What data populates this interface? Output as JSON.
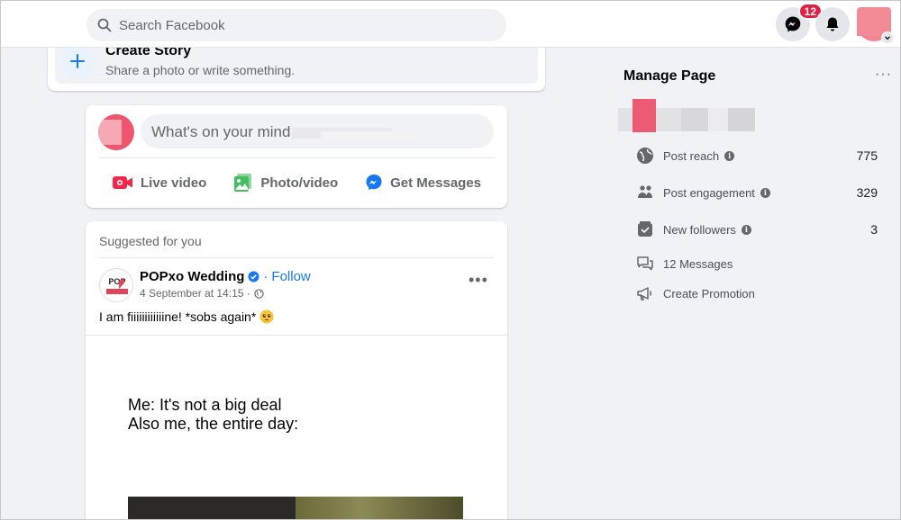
{
  "topbar": {
    "search_placeholder": "Search Facebook",
    "messenger_badge": "12"
  },
  "story": {
    "title": "Create Story",
    "subtitle": "Share a photo or write something."
  },
  "composer": {
    "prompt": "What's on your mind,",
    "actions": [
      {
        "label": "Live video",
        "icon": "live-video-icon",
        "color": "#f02849"
      },
      {
        "label": "Photo/video",
        "icon": "photo-video-icon",
        "color": "#45bd62"
      },
      {
        "label": "Get Messages",
        "icon": "messenger-icon",
        "color": "#1877f2"
      }
    ]
  },
  "post": {
    "section_label": "Suggested for you",
    "author": "POPxo Wedding",
    "follow": "Follow",
    "separator": "·",
    "timestamp": "4 September at 14:15 ·",
    "text": "I am fiiiiiiiiiiiine! *sobs again*",
    "meme_line1": "Me: It's not a big deal",
    "meme_line2": "Also me, the entire day:"
  },
  "manage_page": {
    "title": "Manage Page",
    "more": "···",
    "stats": [
      {
        "label": "Post reach",
        "value": "775",
        "icon": "globe-icon",
        "info": true
      },
      {
        "label": "Post engagement",
        "value": "329",
        "icon": "people-icon",
        "info": true
      },
      {
        "label": "New followers",
        "value": "3",
        "icon": "followers-icon",
        "info": true
      }
    ],
    "links": [
      {
        "label": "12 Messages",
        "icon": "chat-bubble-icon"
      },
      {
        "label": "Create Promotion",
        "icon": "megaphone-icon"
      }
    ]
  },
  "colors": {
    "brand_blue": "#1877f2",
    "badge_red": "#e41e3f",
    "background": "#f0f2f5"
  }
}
